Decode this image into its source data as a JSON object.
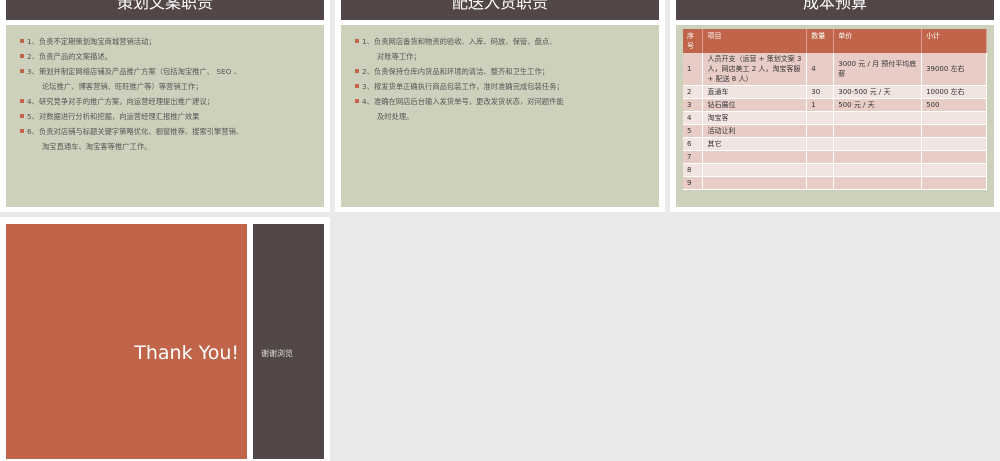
{
  "slides": [
    {
      "title": "策划文案职责",
      "items": [
        {
          "num": "1",
          "text": "、负责不定期策划淘宝商城营销活动；"
        },
        {
          "num": "2",
          "text": "、负责产品的文案描述。"
        },
        {
          "num": "3",
          "text": "、策划并制定网络店铺及产品推广方案（包括淘宝推广、 SEO 、",
          "cont": "论坛推广、博客营销、旺旺推广等）等营销工作；"
        },
        {
          "num": "4",
          "text": "、研究竞争对手的推广方案，向运营经理提出推广建议；"
        },
        {
          "num": "5",
          "text": "、对数据进行分析和挖掘，向运营经理汇报推广效果"
        },
        {
          "num": "6",
          "text": "、负责对店铺与标题关键字策略优化、橱窗推荐、搜索引擎营销、",
          "cont": "淘宝直通车、淘宝客等推广工作。"
        }
      ]
    },
    {
      "title": "配送入货职责",
      "items": [
        {
          "num": "1",
          "text": "、负责网店备货和物资的验收、入库、码放、保管、盘点、",
          "cont": "对账等工作；"
        },
        {
          "num": "2",
          "text": "、负责保持仓库内货品和环境的清洁、整齐和卫生工作；"
        },
        {
          "num": "3",
          "text": "、按发货单正确执行商品包装工作，准时准确完成包装任务；"
        },
        {
          "num": "4",
          "text": "、准确在网店后台输入发货单号，更改发货状态，对问题件能",
          "cont": "及时处理。"
        }
      ]
    },
    {
      "title": "成本预算",
      "headers": [
        "序号",
        "项目",
        "数量",
        "单价",
        "小计"
      ],
      "rows": [
        [
          "1",
          "人员开支（运营 + 策划文案 3 人，网店美工 2 人，淘宝客服 + 配送 8 人）",
          "4",
          "3000 元 / 月 预付平均底薪",
          "39000 左右"
        ],
        [
          "2",
          "直通车",
          "30",
          "300-500 元 / 天",
          "10000 左右"
        ],
        [
          "3",
          "钻石展位",
          "1",
          "500 元 / 天",
          "500"
        ],
        [
          "4",
          "淘宝客",
          "",
          "",
          ""
        ],
        [
          "5",
          "活动让利",
          "",
          "",
          ""
        ],
        [
          "6",
          "其它",
          "",
          "",
          ""
        ],
        [
          "7",
          "",
          "",
          "",
          ""
        ],
        [
          "8",
          "",
          "",
          "",
          ""
        ],
        [
          "9",
          "",
          "",
          "",
          ""
        ]
      ]
    },
    {
      "thanks": "Thank You!",
      "side": "谢谢浏览"
    }
  ]
}
